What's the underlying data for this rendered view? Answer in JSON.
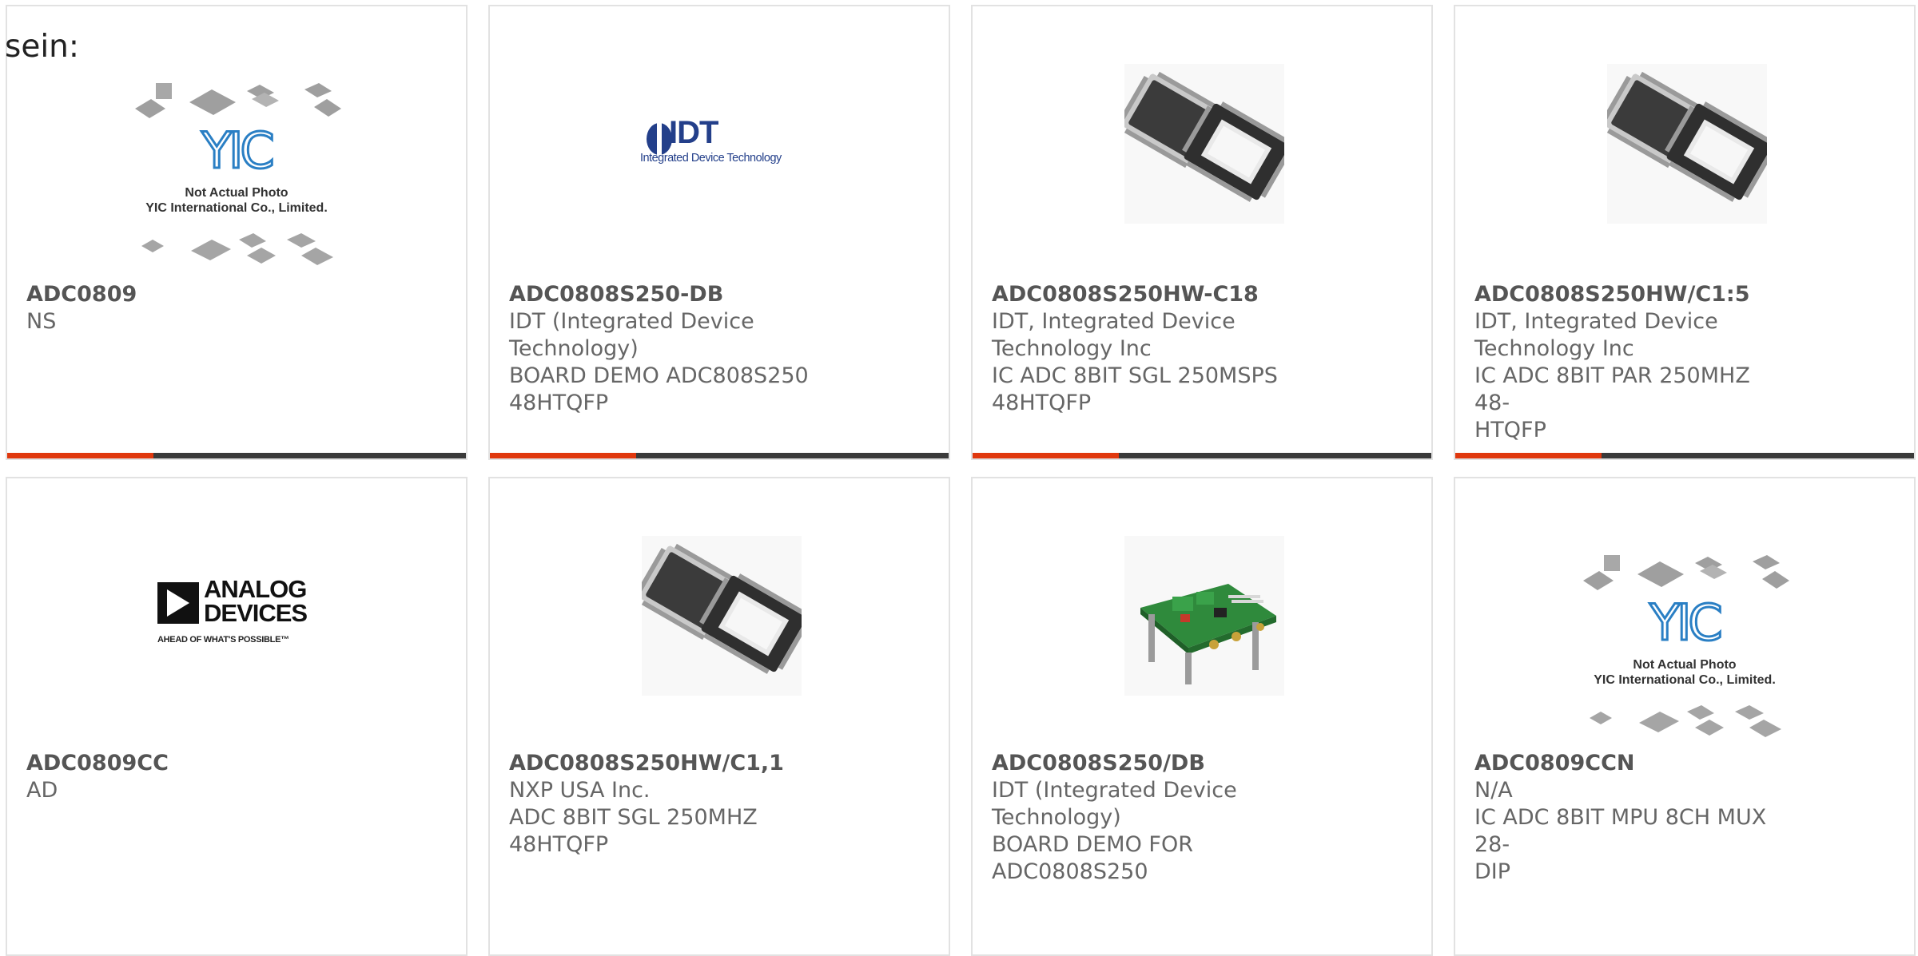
{
  "intro_text": "sein:",
  "placeholder_image": {
    "brand": "YIC",
    "line1": "Not Actual Photo",
    "line2": "YIC International Co., Limited."
  },
  "idt_logo": {
    "mark": "IDT",
    "tagline": "Integrated Device Technology"
  },
  "adi_logo": {
    "line1": "ANALOG",
    "line2": "DEVICES",
    "tagline": "AHEAD OF WHAT'S POSSIBLE™"
  },
  "colors": {
    "accent": "#e0380e",
    "bar": "#3a3a3a",
    "border": "#e2e2e2",
    "text": "#666666"
  },
  "products": [
    {
      "part": "ADC0809",
      "lines": [
        "NS"
      ],
      "image": "placeholder-photo"
    },
    {
      "part": "ADC0808S250-DB",
      "lines": [
        "IDT (Integrated Device",
        "Technology)",
        "BOARD DEMO ADC808S250",
        "48HTQFP"
      ],
      "image": "idt-logo"
    },
    {
      "part": "ADC0808S250HW-C18",
      "lines": [
        "IDT, Integrated Device",
        "Technology Inc",
        "IC ADC 8BIT SGL 250MSPS",
        "48HTQFP"
      ],
      "image": "htqfp-chip-photo"
    },
    {
      "part": "ADC0808S250HW/C1:5",
      "lines": [
        "IDT, Integrated Device",
        "Technology Inc",
        "IC ADC 8BIT PAR 250MHZ 48-",
        "HTQFP"
      ],
      "image": "htqfp-chip-photo"
    },
    {
      "part": "ADC0809CC",
      "lines": [
        "AD"
      ],
      "image": "analog-devices-logo"
    },
    {
      "part": "ADC0808S250HW/C1,1",
      "lines": [
        "NXP USA Inc.",
        "ADC 8BIT SGL 250MHZ 48HTQFP"
      ],
      "image": "htqfp-chip-photo"
    },
    {
      "part": "ADC0808S250/DB",
      "lines": [
        "IDT (Integrated Device",
        "Technology)",
        "BOARD DEMO FOR ADC0808S250"
      ],
      "image": "demo-board-photo"
    },
    {
      "part": "ADC0809CCN",
      "lines": [
        "N/A",
        "IC ADC 8BIT MPU 8CH MUX 28-",
        "DIP"
      ],
      "image": "placeholder-photo"
    }
  ]
}
